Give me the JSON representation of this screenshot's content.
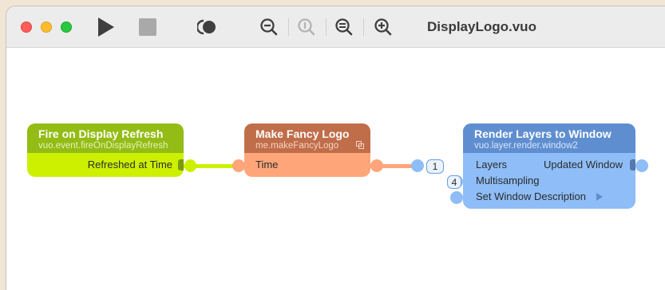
{
  "window": {
    "title": "DisplayLogo.vuo"
  },
  "colors": {
    "close": "#ff5f57",
    "minimize": "#febc2e",
    "maximize": "#28c840",
    "event_node": "#ccf000",
    "logo_node": "#ffa57a",
    "layer_node": "#8ebdf7"
  },
  "toolbar": {
    "icons": [
      "play-icon",
      "stop-icon",
      "show-events-icon",
      "zoom-out-icon",
      "zoom-to-fit-icon",
      "actual-size-icon",
      "zoom-in-icon"
    ]
  },
  "nodes": {
    "fire": {
      "title": "Fire on Display Refresh",
      "class_name": "vuo.event.fireOnDisplayRefresh",
      "output": "Refreshed at Time"
    },
    "logo": {
      "title": "Make Fancy Logo",
      "class_name": "me.makeFancyLogo",
      "input": "Time"
    },
    "render": {
      "title": "Render Layers to Window",
      "class_name": "vuo.layer.render.window2",
      "inputs": [
        "Layers",
        "Multisampling",
        "Set Window Description"
      ],
      "output": "Updated Window",
      "layers_count": "1",
      "multisampling_value": "4"
    }
  }
}
